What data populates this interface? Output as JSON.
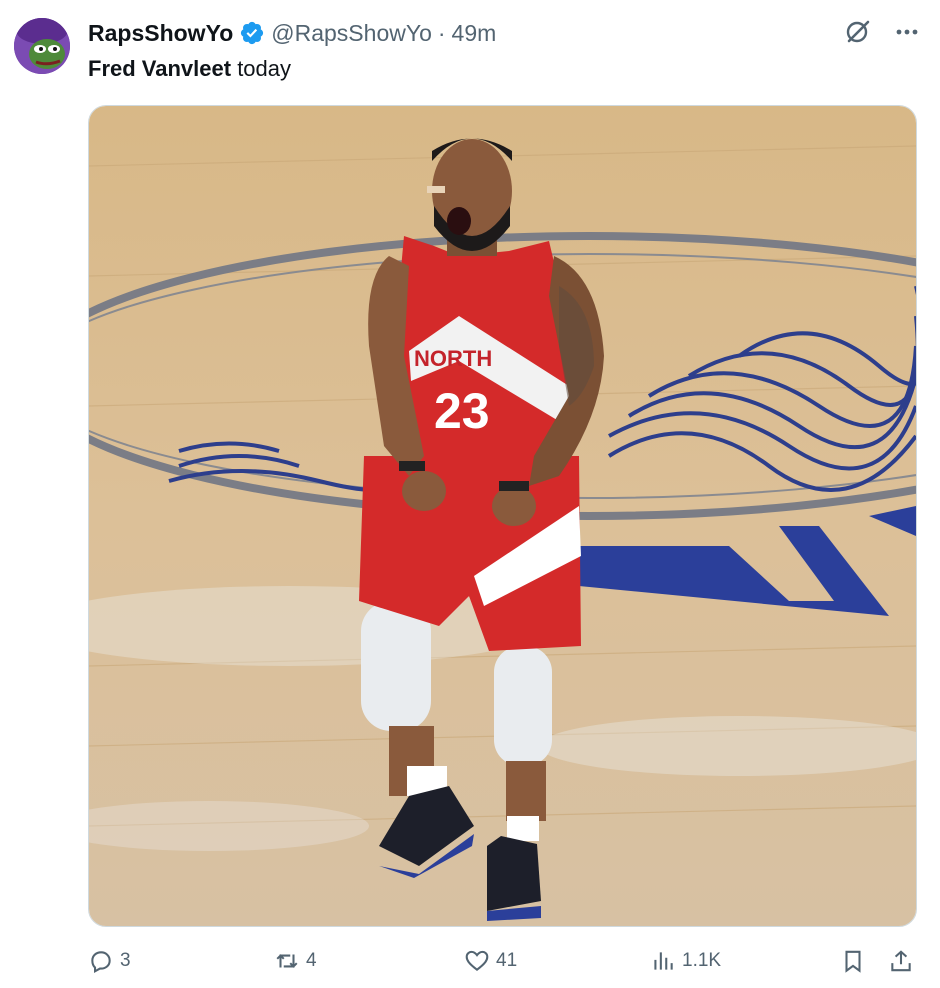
{
  "post": {
    "author": {
      "display_name": "RapsShowYo",
      "handle": "@RapsShowYo",
      "verified": true,
      "avatar_icon": "pepe-avatar"
    },
    "separator": "·",
    "time_ago": "49m",
    "text_bold": "Fred Vanvleet",
    "text_rest": " today",
    "media": {
      "alt_subject": "basketball-player-celebrating",
      "jersey_text": "NORTH",
      "jersey_number": "23"
    },
    "actions": {
      "replies": "3",
      "reposts": "4",
      "likes": "41",
      "views": "1.1K"
    }
  },
  "colors": {
    "verified_blue": "#1d9bf0",
    "muted_text": "#536471",
    "jersey_red": "#d42a2a",
    "court_wood": "#d9b88a"
  }
}
